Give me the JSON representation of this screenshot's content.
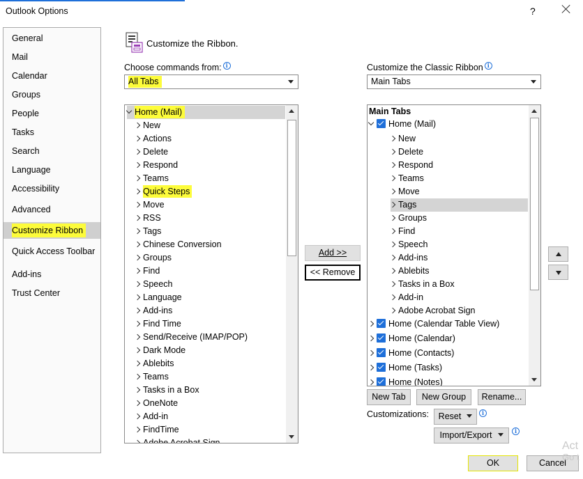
{
  "window": {
    "title": "Outlook Options",
    "help": "?"
  },
  "nav": {
    "items": [
      "General",
      "Mail",
      "Calendar",
      "Groups",
      "People",
      "Tasks",
      "Search",
      "Language",
      "Accessibility",
      "Advanced",
      "Customize Ribbon",
      "Quick Access Toolbar",
      "Add-ins",
      "Trust Center"
    ],
    "selected": "Customize Ribbon"
  },
  "heading": "Customize the Ribbon.",
  "left": {
    "label": "Choose commands from:",
    "combo_value": "All Tabs",
    "root": "Home (Mail)",
    "items": [
      "New",
      "Actions",
      "Delete",
      "Respond",
      "Teams",
      "Quick Steps",
      "Move",
      "RSS",
      "Tags",
      "Chinese Conversion",
      "Groups",
      "Find",
      "Speech",
      "Language",
      "Add-ins",
      "Find Time",
      "Send/Receive (IMAP/POP)",
      "Dark Mode",
      "Ablebits",
      "Teams",
      "Tasks in a Box",
      "OneNote",
      "Add-in",
      "FindTime",
      "Adobe Acrobat Sign"
    ]
  },
  "middle": {
    "add": "Add >>",
    "remove": "<< Remove"
  },
  "right": {
    "label": "Customize the Classic Ribbon",
    "combo_value": "Main Tabs",
    "header": "Main Tabs",
    "root": "Home (Mail)",
    "children": [
      "New",
      "Delete",
      "Respond",
      "Teams",
      "Move",
      "Tags",
      "Groups",
      "Find",
      "Speech",
      "Add-ins",
      "Ablebits",
      "Tasks in a Box",
      "Add-in",
      "Adobe Acrobat Sign"
    ],
    "selected_child": "Tags",
    "tabs": [
      "Home (Calendar Table View)",
      "Home (Calendar)",
      "Home (Contacts)",
      "Home (Tasks)",
      "Home (Notes)"
    ]
  },
  "buttons": {
    "new_tab": "New Tab",
    "new_group": "New Group",
    "rename": "Rename...",
    "customizations_label": "Customizations:",
    "reset": "Reset",
    "import_export": "Import/Export",
    "ok": "OK",
    "cancel": "Cancel"
  },
  "watermark": [
    "Act",
    "Go t"
  ],
  "colors": {
    "highlight": "#fdfc3a",
    "accent": "#1e6fd9",
    "selection": "#cfcfcf"
  }
}
